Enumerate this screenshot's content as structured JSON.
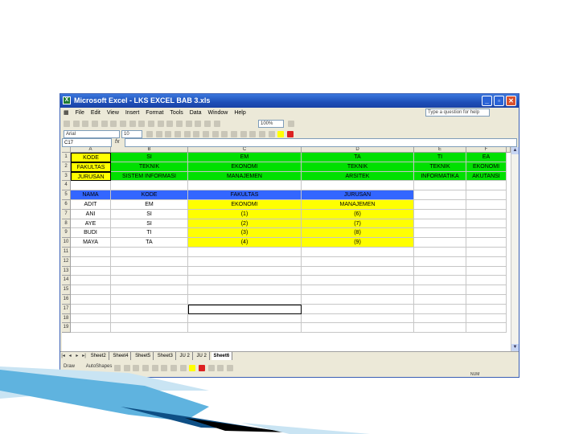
{
  "window": {
    "title": "Microsoft Excel - LKS EXCEL BAB 3.xls",
    "app_icon": "excel-icon",
    "title_color": "#1e4fb8"
  },
  "menu": {
    "items": [
      "File",
      "Edit",
      "View",
      "Insert",
      "Format",
      "Tools",
      "Data",
      "Window",
      "Help"
    ],
    "help_placeholder": "Type a question for help"
  },
  "toolbar": {
    "zoom": "100%",
    "font": "Arial",
    "font_size": "10"
  },
  "name_box": "C17",
  "formula_symbol": "fx",
  "columns": [
    "A",
    "B",
    "C",
    "D",
    "E",
    "F"
  ],
  "rows": [
    "1",
    "2",
    "3",
    "4",
    "5",
    "6",
    "7",
    "8",
    "9",
    "10",
    "11",
    "12",
    "13",
    "14",
    "15",
    "16",
    "17",
    "18",
    "19"
  ],
  "cells": {
    "header_block": {
      "A": [
        "KODE",
        "FAKULTAS",
        "JURUSAN"
      ],
      "B": [
        "SI",
        "TEKNIK",
        "SISTEM INFORMASI"
      ],
      "C": [
        "EM",
        "EKONOMI",
        "MANAJEMEN"
      ],
      "D": [
        "TA",
        "TEKNIK",
        "ARSITEK"
      ],
      "E": [
        "TI",
        "TEKNIK",
        "INFORMATIKA"
      ],
      "F": [
        "EA",
        "EKONOMI",
        "AKUTANSI"
      ]
    },
    "table_header": [
      "NAMA",
      "KODE",
      "FAKULTAS",
      "JURUSAN"
    ],
    "table_rows": [
      [
        "ADIT",
        "EM",
        "EKONOMI",
        "MANAJEMEN"
      ],
      [
        "ANI",
        "SI",
        "(1)",
        "(6)"
      ],
      [
        "AYE",
        "SI",
        "(2)",
        "(7)"
      ],
      [
        "BUDI",
        "TI",
        "(3)",
        "(8)"
      ],
      [
        "MAYA",
        "TA",
        "(4)",
        "(9)"
      ]
    ]
  },
  "sheet_tabs": [
    "Sheet2",
    "Sheet4",
    "Sheet5",
    "Sheet3",
    "JU 2",
    "JU 2",
    "Sheet6"
  ],
  "active_sheet": "Sheet6",
  "draw_toolbar": {
    "draw_label": "Draw",
    "autoshapes_label": "AutoShapes"
  },
  "status": "NUM",
  "colors": {
    "green": "#00e000",
    "blue": "#3366ff",
    "yellow": "#ffff00"
  }
}
